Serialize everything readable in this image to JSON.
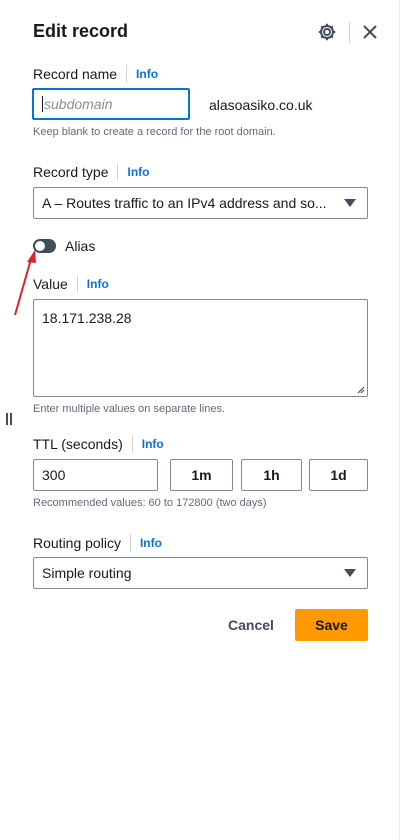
{
  "panel": {
    "title": "Edit record",
    "icons": {
      "settings": "gear-icon",
      "close": "close-icon"
    }
  },
  "record_name": {
    "label": "Record name",
    "info": "Info",
    "placeholder": "subdomain",
    "value": "",
    "domain_suffix": "alasoasiko.co.uk",
    "hint": "Keep blank to create a record for the root domain."
  },
  "record_type": {
    "label": "Record type",
    "info": "Info",
    "selected": "A – Routes traffic to an IPv4 address and so..."
  },
  "alias": {
    "label": "Alias",
    "enabled": false
  },
  "value_field": {
    "label": "Value",
    "info": "Info",
    "value": "18.171.238.28",
    "hint": "Enter multiple values on separate lines."
  },
  "ttl": {
    "label": "TTL (seconds)",
    "info": "Info",
    "value": "300",
    "presets": [
      "1m",
      "1h",
      "1d"
    ],
    "hint": "Recommended values: 60 to 172800 (two days)"
  },
  "routing_policy": {
    "label": "Routing policy",
    "info": "Info",
    "selected": "Simple routing"
  },
  "actions": {
    "cancel": "Cancel",
    "save": "Save"
  },
  "colors": {
    "accent_link": "#0972d3",
    "primary_button": "#ff9900",
    "annotation_arrow": "#e0202c"
  }
}
